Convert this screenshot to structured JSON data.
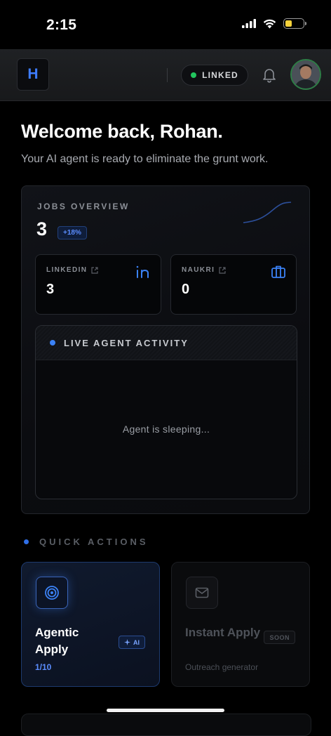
{
  "status_bar": {
    "time": "2:15"
  },
  "header": {
    "logo_letter": "H",
    "linked_label": "LINKED"
  },
  "welcome": {
    "title": "Welcome back, Rohan.",
    "subtitle": "Your AI agent is ready to eliminate the grunt work."
  },
  "jobs_overview": {
    "label": "JOBS OVERVIEW",
    "count": "3",
    "change_badge": "+18%",
    "sources": [
      {
        "label": "LINKEDIN",
        "value": "3",
        "icon": "linkedin-icon"
      },
      {
        "label": "NAUKRI",
        "value": "0",
        "icon": "briefcase-icon"
      }
    ],
    "activity": {
      "title": "LIVE AGENT ACTIVITY",
      "status": "Agent is sleeping..."
    }
  },
  "quick_actions": {
    "title": "QUICK ACTIONS",
    "items": [
      {
        "name": "Agentic Apply",
        "tag": "AI",
        "sub": "1/10",
        "icon": "target-icon",
        "accent": "#3b82f6"
      },
      {
        "name": "Instant Apply",
        "tag": "SOON",
        "sub": "Outreach generator",
        "icon": "mail-icon"
      }
    ]
  },
  "colors": {
    "accent": "#3b82f6",
    "linked_dot": "#22c55e",
    "battery": "#f6d23a"
  }
}
